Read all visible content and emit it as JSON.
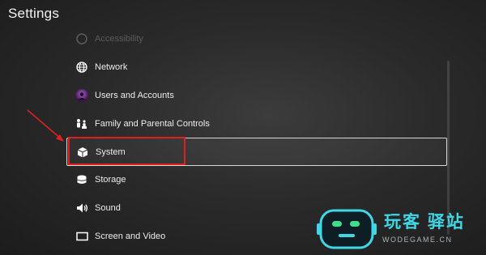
{
  "page": {
    "title": "Settings"
  },
  "menu": {
    "items": [
      {
        "label": "Accessibility",
        "icon": "accessibility-icon"
      },
      {
        "label": "Network",
        "icon": "globe-icon"
      },
      {
        "label": "Users and Accounts",
        "icon": "user-avatar-icon"
      },
      {
        "label": "Family and Parental Controls",
        "icon": "family-icon"
      },
      {
        "label": "System",
        "icon": "cube-icon"
      },
      {
        "label": "Storage",
        "icon": "storage-icon"
      },
      {
        "label": "Sound",
        "icon": "speaker-icon"
      },
      {
        "label": "Screen and Video",
        "icon": "screen-icon"
      }
    ],
    "selected": "System"
  },
  "colors": {
    "annotation_red": "#e02020",
    "watermark_cyan": "#3fd7e6"
  },
  "watermark": {
    "title": "玩客 驿站",
    "subtitle": "WODEGAME.CN"
  }
}
